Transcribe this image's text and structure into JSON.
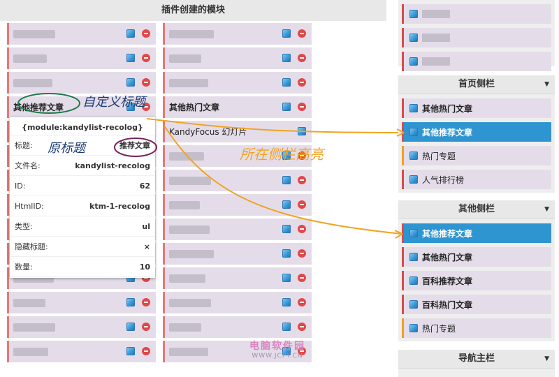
{
  "panel": {
    "title": "插件创建的模块"
  },
  "modules": {
    "col_a": [
      {
        "type": "blur",
        "w": 60
      },
      {
        "type": "blur",
        "w": 48
      },
      {
        "type": "blur",
        "w": 56
      },
      {
        "type": "title",
        "text": "其他推荐文章"
      },
      {
        "type": "blur",
        "w": 40
      },
      {
        "type": "blur",
        "w": 60
      },
      {
        "type": "blur",
        "w": 50
      },
      {
        "type": "blur",
        "w": 44
      },
      {
        "type": "blur",
        "w": 60
      },
      {
        "type": "blur",
        "w": 52
      },
      {
        "type": "blur",
        "w": 58
      },
      {
        "type": "blur",
        "w": 46
      },
      {
        "type": "blur",
        "w": 60
      },
      {
        "type": "blur",
        "w": 50
      }
    ],
    "col_b": [
      {
        "type": "blur",
        "w": 64
      },
      {
        "type": "blur",
        "w": 46
      },
      {
        "type": "blur",
        "w": 56
      },
      {
        "type": "title",
        "text": "其他热门文章"
      },
      {
        "type": "plain",
        "text": "KandyFocus 幻灯片",
        "no_delete": true
      },
      {
        "type": "blur",
        "w": 50
      },
      {
        "type": "blur",
        "w": 60
      },
      {
        "type": "blur",
        "w": 44
      },
      {
        "type": "blur",
        "w": 58
      },
      {
        "type": "blur",
        "w": 64
      },
      {
        "type": "blur",
        "w": 52
      },
      {
        "type": "blur",
        "w": 60
      },
      {
        "type": "blur",
        "w": 46
      },
      {
        "type": "blur",
        "w": 56
      }
    ]
  },
  "info_card": {
    "title": "{module:kandylist-recolog}",
    "rows": [
      {
        "k": "标题:",
        "v": "推荐文章"
      },
      {
        "k": "文件名:",
        "v": "kandylist-recolog"
      },
      {
        "k": "ID:",
        "v": "62"
      },
      {
        "k": "HtmlID:",
        "v": "ktm-1-recolog"
      },
      {
        "k": "类型:",
        "v": "ul"
      },
      {
        "k": "隐藏标题:",
        "v": "×"
      },
      {
        "k": "数量:",
        "v": "10"
      }
    ]
  },
  "sidebar": {
    "groups": [
      {
        "title": "首页侧栏",
        "items": [
          {
            "label": "其他热门文章",
            "state": "normal"
          },
          {
            "label": "其他推荐文章",
            "state": "active"
          },
          {
            "label": "热门专题",
            "state": "plain-orange"
          },
          {
            "label": "人气排行榜",
            "state": "plain"
          }
        ]
      },
      {
        "title": "其他侧栏",
        "items": [
          {
            "label": "其他推荐文章",
            "state": "active"
          },
          {
            "label": "其他热门文章",
            "state": "normal"
          },
          {
            "label": "百科推荐文章",
            "state": "normal"
          },
          {
            "label": "百科热门文章",
            "state": "normal"
          },
          {
            "label": "热门专题",
            "state": "plain-orange"
          }
        ]
      },
      {
        "title": "导航主栏",
        "items": []
      }
    ]
  },
  "annotations": {
    "custom_title": "自定义标题",
    "original_title": "原标题",
    "placed_sidebar_highlight": "所在侧栏高亮"
  },
  "watermark": {
    "logo": "电脑软件园",
    "url": "WWW.JCPY.CN"
  }
}
